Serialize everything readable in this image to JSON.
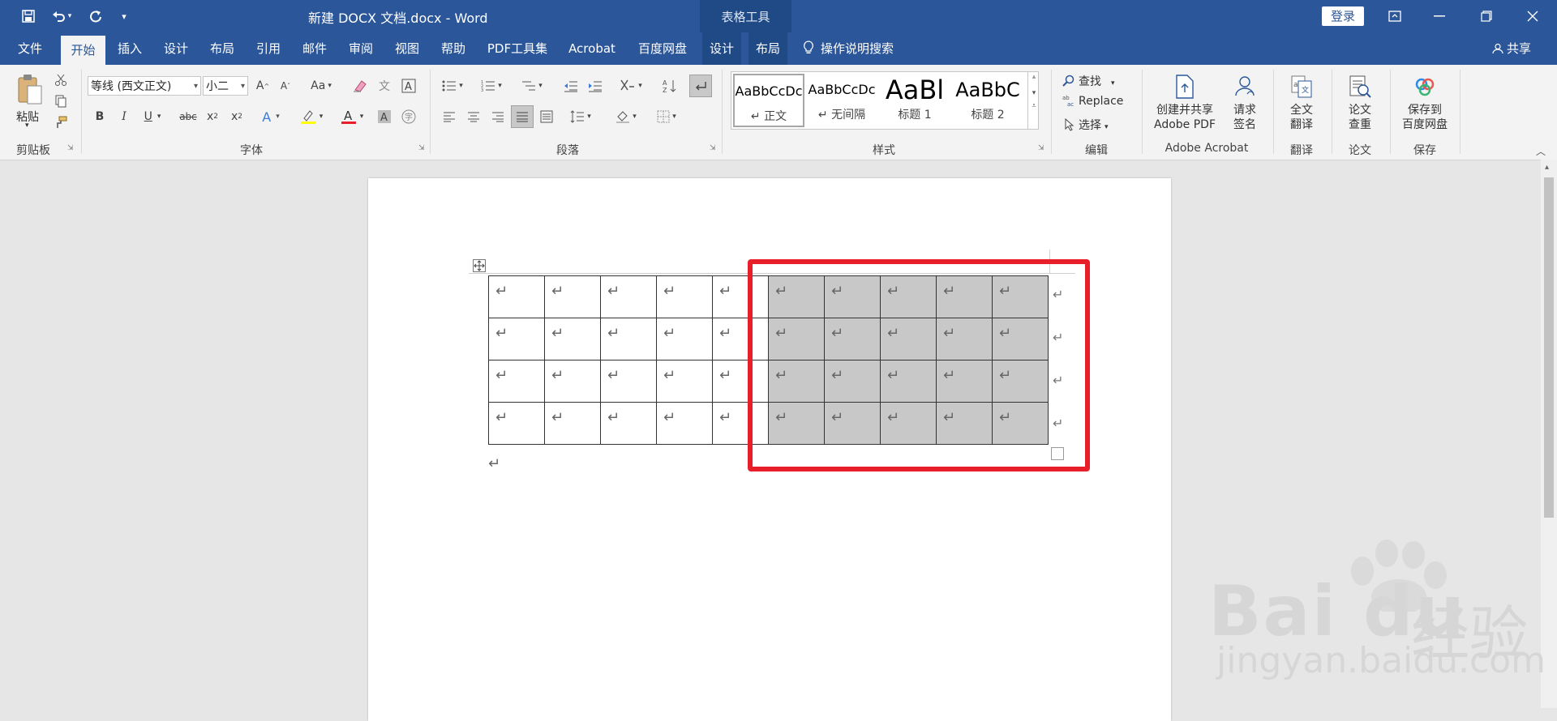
{
  "title_bar": {
    "doc_title": "新建 DOCX 文档.docx  -  Word",
    "context_title": "表格工具",
    "login_label": "登录"
  },
  "tabs": [
    {
      "label": "文件",
      "active": false
    },
    {
      "label": "开始",
      "active": true
    },
    {
      "label": "插入",
      "active": false
    },
    {
      "label": "设计",
      "active": false
    },
    {
      "label": "布局",
      "active": false
    },
    {
      "label": "引用",
      "active": false
    },
    {
      "label": "邮件",
      "active": false
    },
    {
      "label": "审阅",
      "active": false
    },
    {
      "label": "视图",
      "active": false
    },
    {
      "label": "帮助",
      "active": false
    },
    {
      "label": "PDF工具集",
      "active": false
    },
    {
      "label": "Acrobat",
      "active": false
    },
    {
      "label": "百度网盘",
      "active": false
    },
    {
      "label": "设计",
      "active": false
    },
    {
      "label": "布局",
      "active": false
    }
  ],
  "search_label": "操作说明搜索",
  "share_label": "共享",
  "ribbon": {
    "clipboard": {
      "paste_label": "粘贴",
      "group_label": "剪贴板"
    },
    "font": {
      "font_name": "等线 (西文正文)",
      "font_size": "小二",
      "change_case": "Aa",
      "group_label": "字体"
    },
    "paragraph": {
      "group_label": "段落"
    },
    "styles": {
      "items": [
        {
          "preview": "AaBbCcDc",
          "name": "↵ 正文",
          "selected": true
        },
        {
          "preview": "AaBbCcDc",
          "name": "↵ 无间隔",
          "selected": false
        },
        {
          "preview": "AaBl",
          "name": "标题 1",
          "selected": false
        },
        {
          "preview": "AaBbC",
          "name": "标题 2",
          "selected": false
        }
      ],
      "group_label": "样式"
    },
    "editing": {
      "find_label": "查找",
      "replace_label": "Replace",
      "select_label": "选择",
      "group_label": "编辑"
    },
    "acrobat": {
      "create_line1": "创建并共享",
      "create_line2": "Adobe PDF",
      "sign_line1": "请求",
      "sign_line2": "签名",
      "group_label": "Adobe Acrobat"
    },
    "translate": {
      "line1": "全文",
      "line2": "翻译",
      "group_label": "翻译"
    },
    "paper": {
      "line1": "论文",
      "line2": "查重",
      "group_label": "论文"
    },
    "save": {
      "line1": "保存到",
      "line2": "百度网盘",
      "group_label": "保存"
    }
  },
  "document": {
    "table": {
      "rows": 4,
      "cols": 10,
      "shaded_from_col": 5,
      "cell_mark": "↵",
      "row_end_mark": "↵"
    },
    "after_table_mark": "↵"
  },
  "watermark": {
    "logo": "Bai du",
    "cn": "经验",
    "url": "jingyan.baidu.com"
  },
  "colors": {
    "accent": "#2b579a",
    "highlight_box": "#e81e2a",
    "shaded_cell": "#c8c8c8"
  }
}
